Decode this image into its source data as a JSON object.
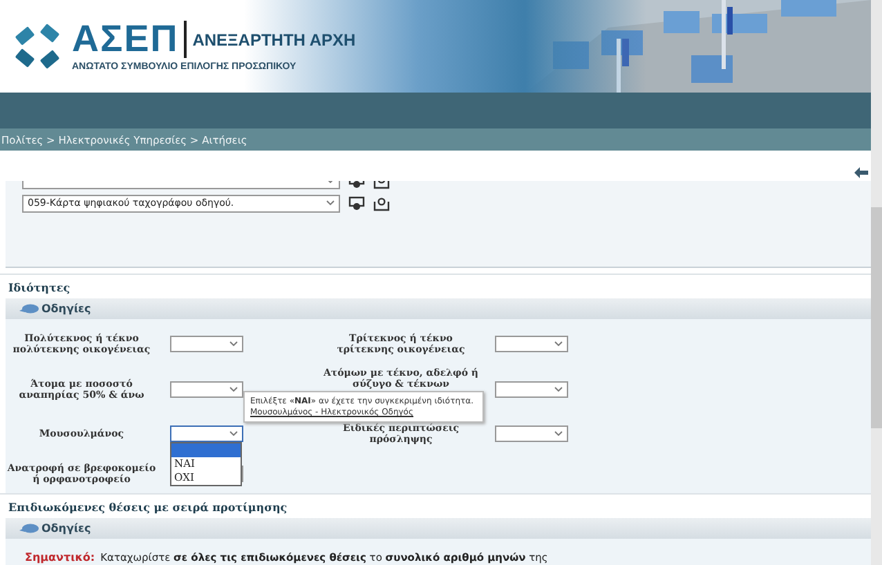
{
  "header": {
    "logo_title": "ΑΣΕΠ",
    "logo_subtitle": "ΑΝΕΞΑΡΤΗΤΗ ΑΡΧΗ",
    "logo_tagline": "ΑΝΩΤΑΤΟ ΣΥΜΒΟΥΛΙΟ ΕΠΙΛΟΓΗΣ ΠΡΟΣΩΠΙΚΟΥ"
  },
  "breadcrumb": "Πολίτες > Ηλεκτρονικές Υπηρεσίες > Αιτήσεις",
  "documents": [
    {
      "kind": "partial"
    },
    {
      "kind": "full",
      "value": "059-Κάρτα ψηφιακού ταχογράφου οδηγού."
    }
  ],
  "properties": {
    "title": "Ιδιότητες",
    "help": "Οδηγίες",
    "left_fields": [
      {
        "label": "Πολύτεκνος ή τέκνο πολύτεκνης οικογένειας",
        "expanded": false
      },
      {
        "label": "Άτομα με ποσοστό αναπηρίας 50% & άνω",
        "expanded": false
      },
      {
        "label": "Μουσουλμάνος",
        "expanded": true,
        "options": [
          {
            "label": "ΝΑΙ",
            "selected": false
          },
          {
            "label": "ΟΧΙ",
            "selected": false
          }
        ]
      },
      {
        "label": "Ανατροφή σε βρεφοκομείο ή ορφανοτροφείο",
        "expanded": false
      }
    ],
    "right_fields": [
      {
        "label": "Τρίτεκνος ή τέκνο τρίτεκνης οικογένειας",
        "expanded": false
      },
      {
        "label": "Ατόμων με τέκνο, αδελφό ή σύζυγο & τέκνων",
        "expanded": false
      },
      {
        "label": "Ειδικές περιπτώσεις πρόσληψης",
        "expanded": false
      }
    ],
    "tooltip": {
      "text": "Επιλέξτε «**ΝΑΙ**» αν έχετε την συγκεκριμένη ιδιότητα.",
      "link": "Μουσουλμάνος - Ηλεκτρονικός Οδηγός"
    }
  },
  "positions": {
    "title": "Επιδιωκόμενες θέσεις με σειρά προτίμησης",
    "help": "Οδηγίες",
    "note_label": "Σημαντικό:",
    "note": "Καταχωρίστε **σε όλες τις επιδιωκόμενες θέσεις** το **συνολικό αριθμό μηνών** της"
  }
}
